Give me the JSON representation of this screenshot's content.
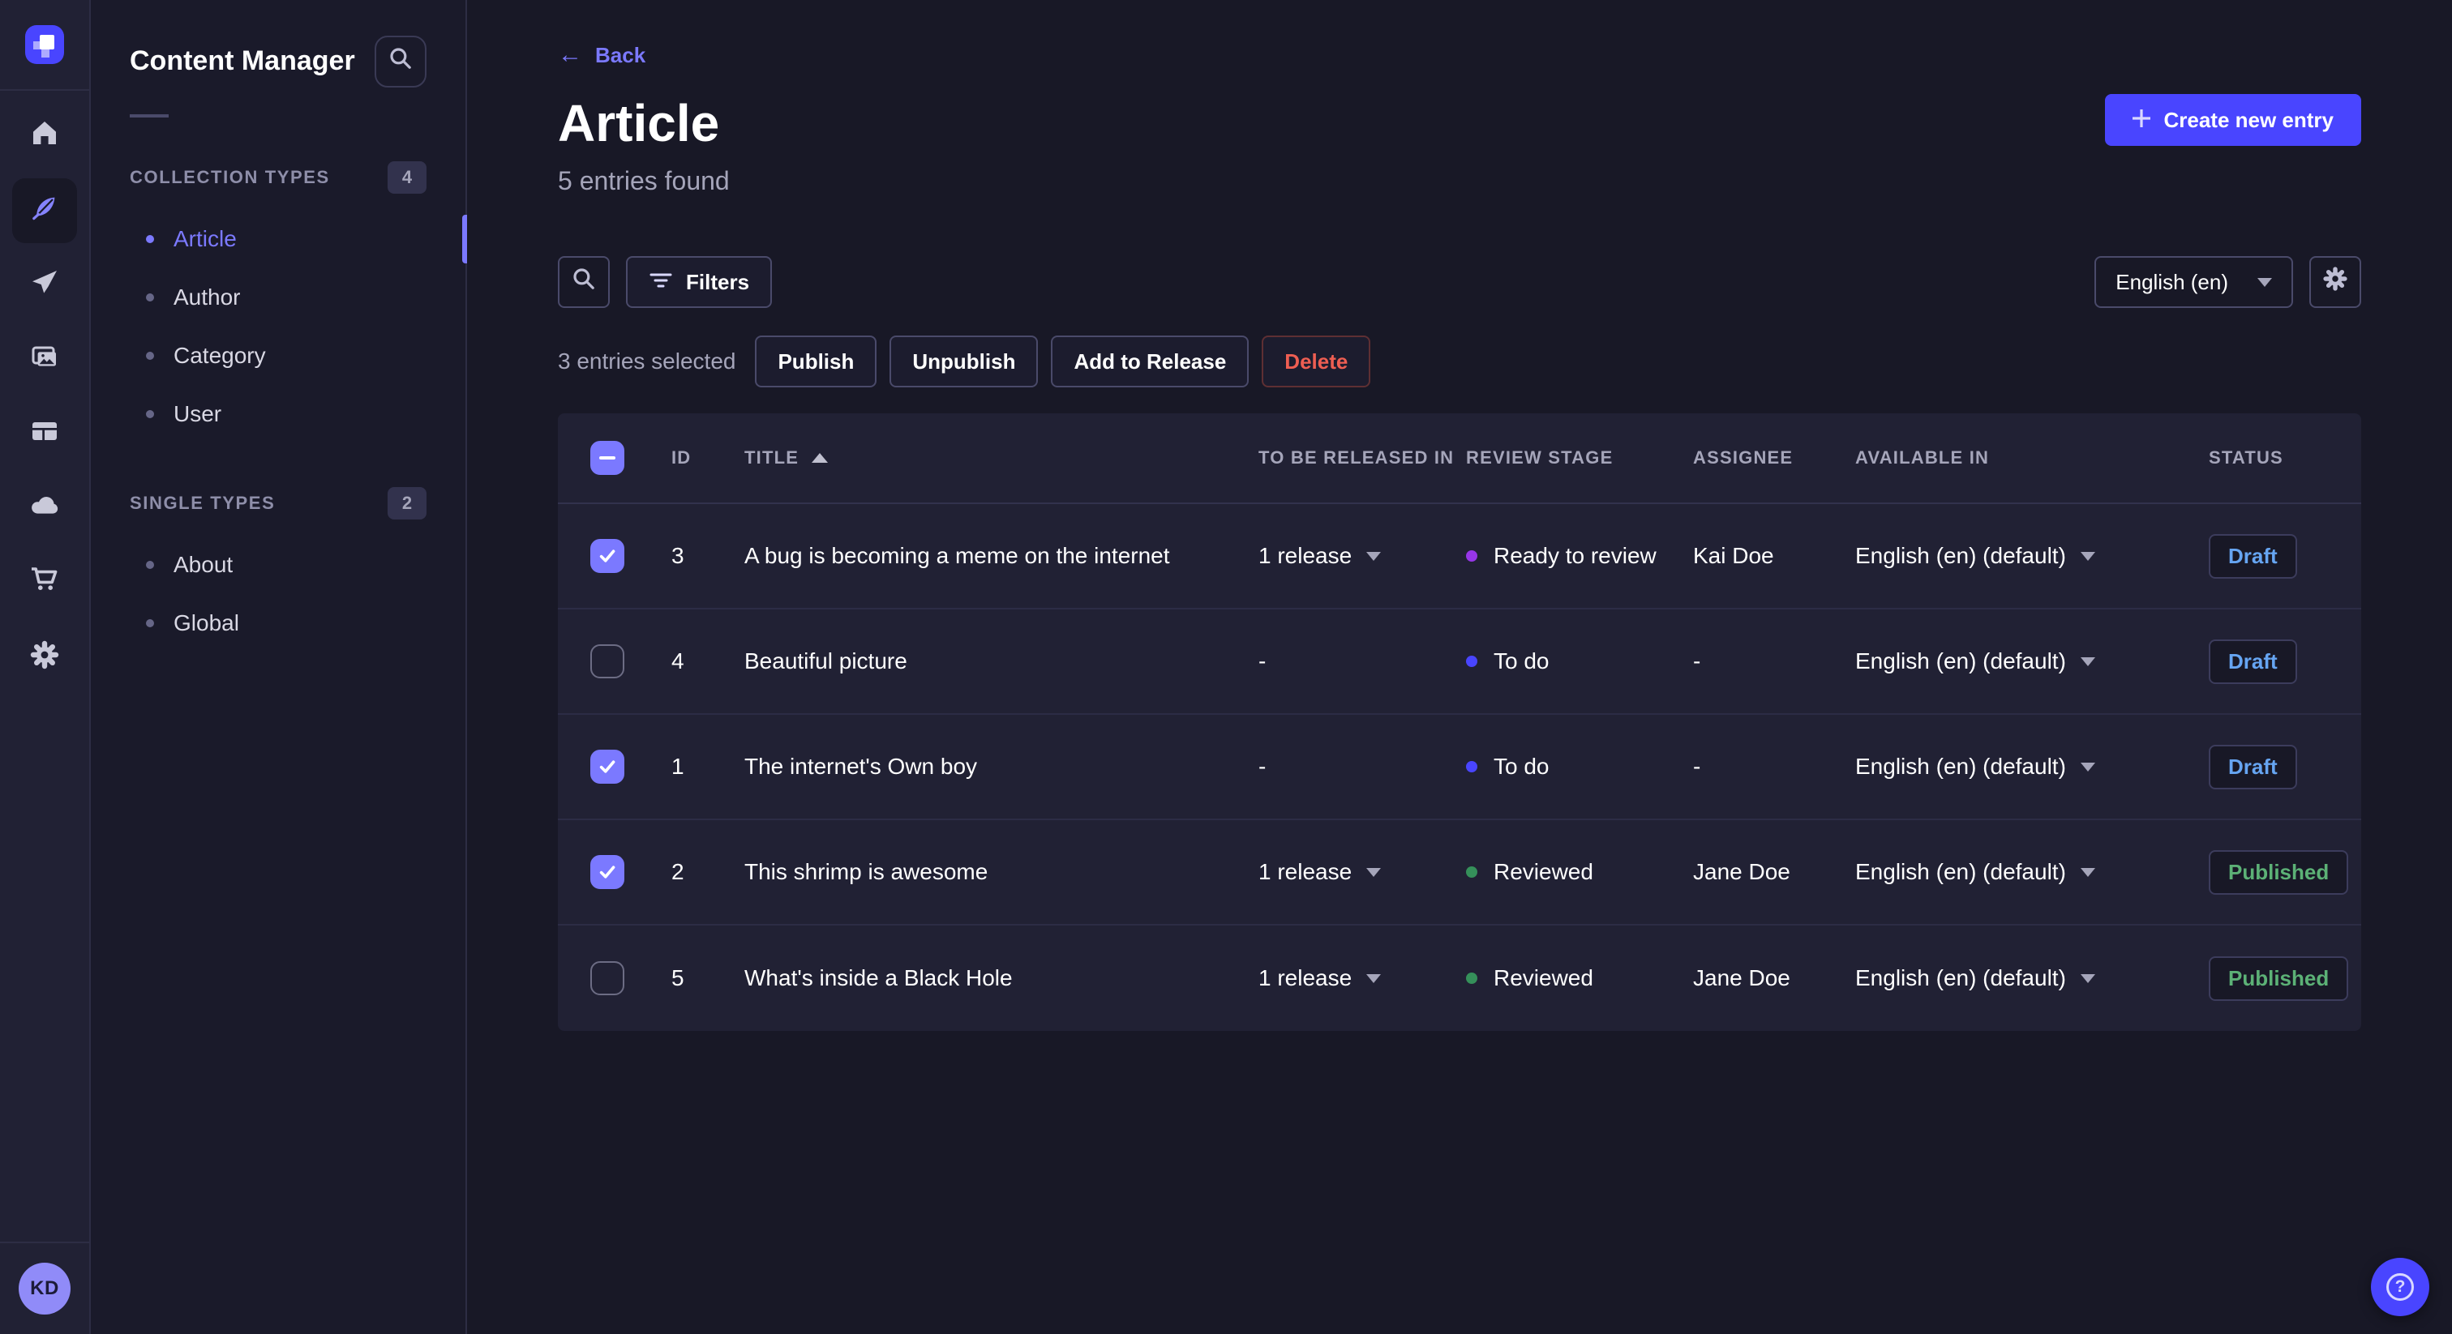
{
  "nav": {
    "items": [
      {
        "name": "home"
      },
      {
        "name": "content-manager",
        "active": true
      },
      {
        "name": "releases"
      },
      {
        "name": "media-library"
      },
      {
        "name": "content-type-builder"
      },
      {
        "name": "cloud"
      },
      {
        "name": "marketplace"
      },
      {
        "name": "settings"
      }
    ],
    "avatar_initials": "KD"
  },
  "subnav": {
    "title": "Content Manager",
    "sections": [
      {
        "label": "COLLECTION TYPES",
        "badge": "4",
        "items": [
          {
            "label": "Article",
            "active": true
          },
          {
            "label": "Author"
          },
          {
            "label": "Category"
          },
          {
            "label": "User"
          }
        ]
      },
      {
        "label": "SINGLE TYPES",
        "badge": "2",
        "items": [
          {
            "label": "About"
          },
          {
            "label": "Global"
          }
        ]
      }
    ]
  },
  "header": {
    "back_label": "Back",
    "title": "Article",
    "subtitle": "5 entries found",
    "create_button": "Create new entry"
  },
  "toolbar": {
    "filters_label": "Filters",
    "locale_selected": "English (en)"
  },
  "selection": {
    "text": "3 entries selected",
    "publish": "Publish",
    "unpublish": "Unpublish",
    "add_to_release": "Add to Release",
    "delete": "Delete"
  },
  "table": {
    "columns": [
      "ID",
      "TITLE",
      "TO BE RELEASED IN",
      "REVIEW STAGE",
      "ASSIGNEE",
      "AVAILABLE IN",
      "STATUS"
    ],
    "sorted_column": "TITLE",
    "sort_direction": "asc",
    "rows": [
      {
        "checked": true,
        "id": "3",
        "title": "A bug is becoming a meme on the internet",
        "release": "1 release",
        "stage": "Ready to review",
        "stage_color": "#9736e8",
        "assignee": "Kai Doe",
        "locale": "English (en) (default)",
        "status": "Draft"
      },
      {
        "checked": false,
        "id": "4",
        "title": "Beautiful picture",
        "release": "-",
        "stage": "To do",
        "stage_color": "#4945ff",
        "assignee": "-",
        "locale": "English (en) (default)",
        "status": "Draft"
      },
      {
        "checked": true,
        "id": "1",
        "title": "The internet's Own boy",
        "release": "-",
        "stage": "To do",
        "stage_color": "#4945ff",
        "assignee": "-",
        "locale": "English (en) (default)",
        "status": "Draft"
      },
      {
        "checked": true,
        "id": "2",
        "title": "This shrimp is awesome",
        "release": "1 release",
        "stage": "Reviewed",
        "stage_color": "#35905a",
        "assignee": "Jane Doe",
        "locale": "English (en) (default)",
        "status": "Published"
      },
      {
        "checked": false,
        "id": "5",
        "title": "What's inside a Black Hole",
        "release": "1 release",
        "stage": "Reviewed",
        "stage_color": "#35905a",
        "assignee": "Jane Doe",
        "locale": "English (en) (default)",
        "status": "Published"
      }
    ]
  },
  "help": {
    "icon_label": "?"
  },
  "colors": {
    "accent": "#4945ff",
    "accent_light": "#7b79ff",
    "background": "#181826",
    "surface": "#212134",
    "draft_text": "#66a5f2",
    "published_text": "#5cb176",
    "danger": "#ee5e52"
  }
}
